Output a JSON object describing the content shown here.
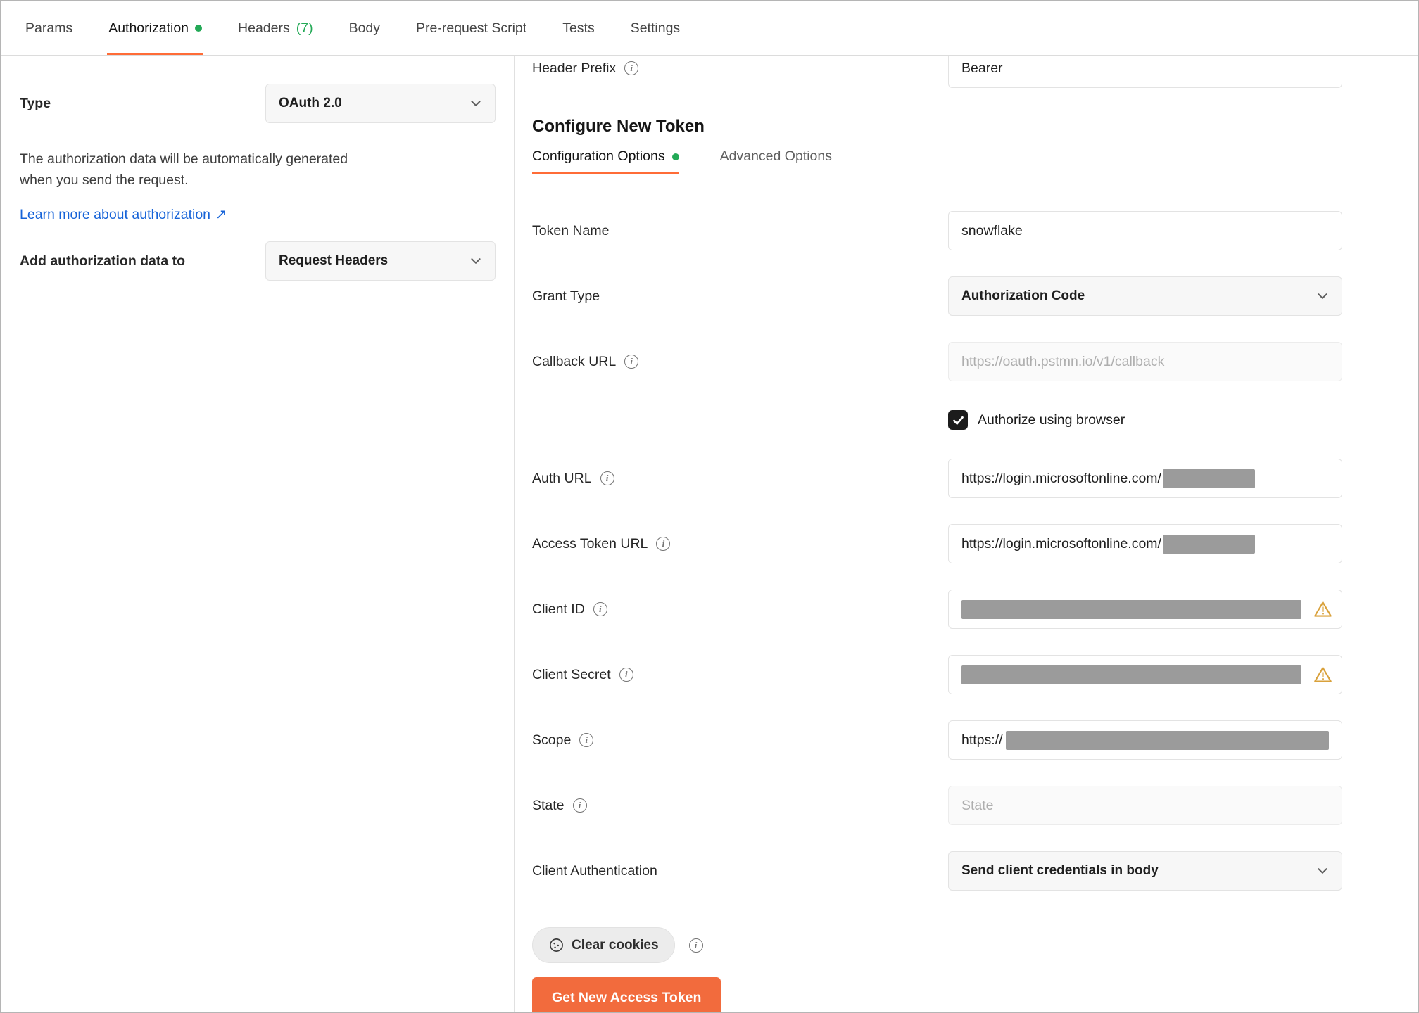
{
  "colors": {
    "accent_orange": "#ff6c37",
    "green": "#23a956",
    "link_blue": "#1663d8",
    "redact_gray": "#9b9b9b"
  },
  "icons": {
    "info_glyph": "i"
  },
  "request_tabs": {
    "params": "Params",
    "authorization": "Authorization",
    "headers": "Headers",
    "headers_count": "(7)",
    "body": "Body",
    "pre_request_script": "Pre-request Script",
    "tests": "Tests",
    "settings": "Settings"
  },
  "auth_panel": {
    "type_label": "Type",
    "type_value": "OAuth 2.0",
    "description_line1": "The authorization data will be automatically generated",
    "description_line2": "when you send the request.",
    "learn_more_link": "Learn more about authorization",
    "learn_more_arrow": "↗",
    "add_to_label": "Add authorization data to",
    "add_to_value": "Request Headers"
  },
  "token_panel": {
    "header_prefix": {
      "label": "Header Prefix",
      "value": "Bearer"
    },
    "section_title": "Configure New Token",
    "tabs": {
      "configuration": "Configuration Options",
      "advanced": "Advanced Options"
    },
    "token_name": {
      "label": "Token Name",
      "value": "snowflake"
    },
    "grant_type": {
      "label": "Grant Type",
      "value": "Authorization Code"
    },
    "callback_url": {
      "label": "Callback URL",
      "placeholder": "https://oauth.pstmn.io/v1/callback"
    },
    "authorize_browser": {
      "label": "Authorize using browser",
      "checked": true
    },
    "auth_url": {
      "label": "Auth URL",
      "value": "https://login.microsoftonline.com/",
      "redacted": true
    },
    "access_token_url": {
      "label": "Access Token URL",
      "value": "https://login.microsoftonline.com/",
      "redacted": true
    },
    "client_id": {
      "label": "Client ID",
      "redacted": true
    },
    "client_secret": {
      "label": "Client Secret",
      "redacted": true
    },
    "scope": {
      "label": "Scope",
      "value": "https://",
      "redacted": true
    },
    "state": {
      "label": "State",
      "placeholder": "State"
    },
    "client_authentication": {
      "label": "Client Authentication",
      "value": "Send client credentials in body"
    },
    "clear_cookies_button": "Clear cookies",
    "get_token_button": "Get New Access Token"
  }
}
